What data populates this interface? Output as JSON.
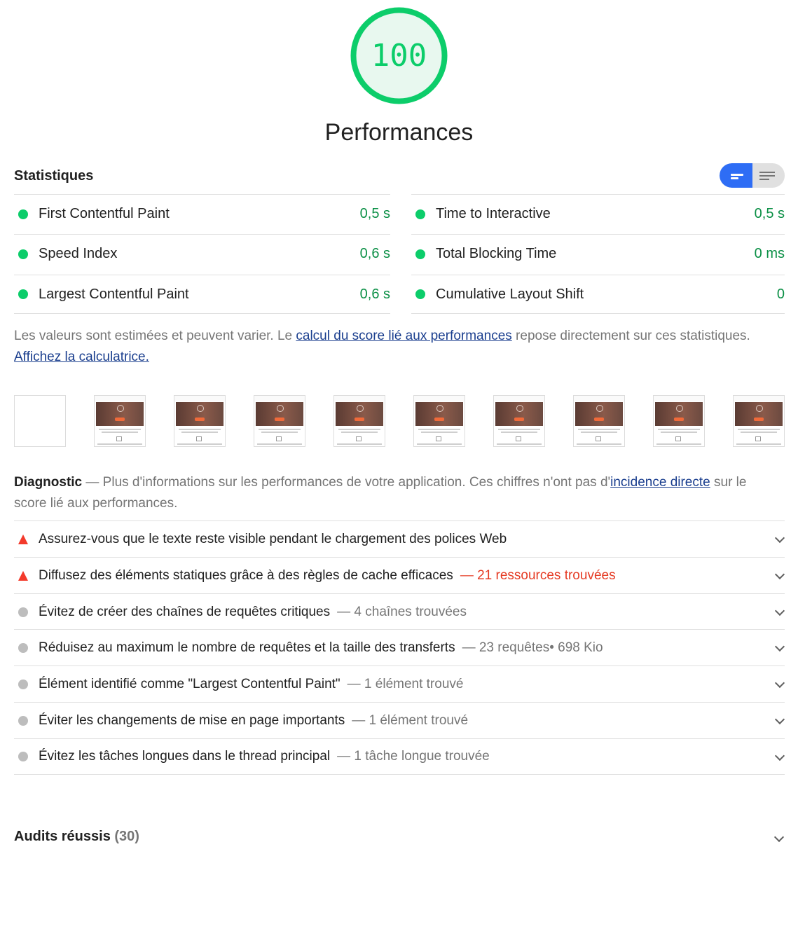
{
  "score": {
    "value": "100",
    "fraction": 1.0,
    "color": "#0ccd6a",
    "title": "Performances"
  },
  "metrics": {
    "title": "Statistiques",
    "items": [
      {
        "label": "First Contentful Paint",
        "value": "0,5 s"
      },
      {
        "label": "Speed Index",
        "value": "0,6 s"
      },
      {
        "label": "Largest Contentful Paint",
        "value": "0,6 s"
      },
      {
        "label": "Time to Interactive",
        "value": "0,5 s"
      },
      {
        "label": "Total Blocking Time",
        "value": "0 ms"
      },
      {
        "label": "Cumulative Layout Shift",
        "value": "0"
      }
    ],
    "note_prefix": "Les valeurs sont estimées et peuvent varier. Le ",
    "note_link1": "calcul du score lié aux performances",
    "note_mid": " repose directement sur ces statistiques. ",
    "note_link2": "Affichez la calculatrice."
  },
  "filmstrip": {
    "frame_count": 10
  },
  "diagnostic": {
    "title": "Diagnostic",
    "intro_prefix": " — Plus d'informations sur les performances de votre application. Ces chiffres n'ont pas d'",
    "intro_link": "incidence directe",
    "intro_suffix": " sur le score lié aux performances.",
    "items": [
      {
        "status": "fail",
        "title": "Assurez-vous que le texte reste visible pendant le chargement des polices Web",
        "detail": ""
      },
      {
        "status": "fail",
        "title": "Diffusez des éléments statiques grâce à des règles de cache efficaces",
        "detail": "— 21 ressources trouvées"
      },
      {
        "status": "info",
        "title": "Évitez de créer des chaînes de requêtes critiques",
        "detail": "— 4 chaînes trouvées"
      },
      {
        "status": "info",
        "title": "Réduisez au maximum le nombre de requêtes et la taille des transferts",
        "detail": "— 23 requêtes• 698 Kio"
      },
      {
        "status": "info",
        "title": "Élément identifié comme \"Largest Contentful Paint\"",
        "detail": "— 1 élément trouvé"
      },
      {
        "status": "info",
        "title": "Éviter les changements de mise en page importants",
        "detail": "— 1 élément trouvé"
      },
      {
        "status": "info",
        "title": "Évitez les tâches longues dans le thread principal",
        "detail": "— 1 tâche longue trouvée"
      }
    ]
  },
  "passed": {
    "label": "Audits réussis",
    "count": "(30)"
  },
  "colors": {
    "pass": "#0ccd6a",
    "fail": "#f33a2b",
    "info": "#bdbdbd",
    "toggle_active": "#2e6df5",
    "link": "#1a3e8e"
  }
}
